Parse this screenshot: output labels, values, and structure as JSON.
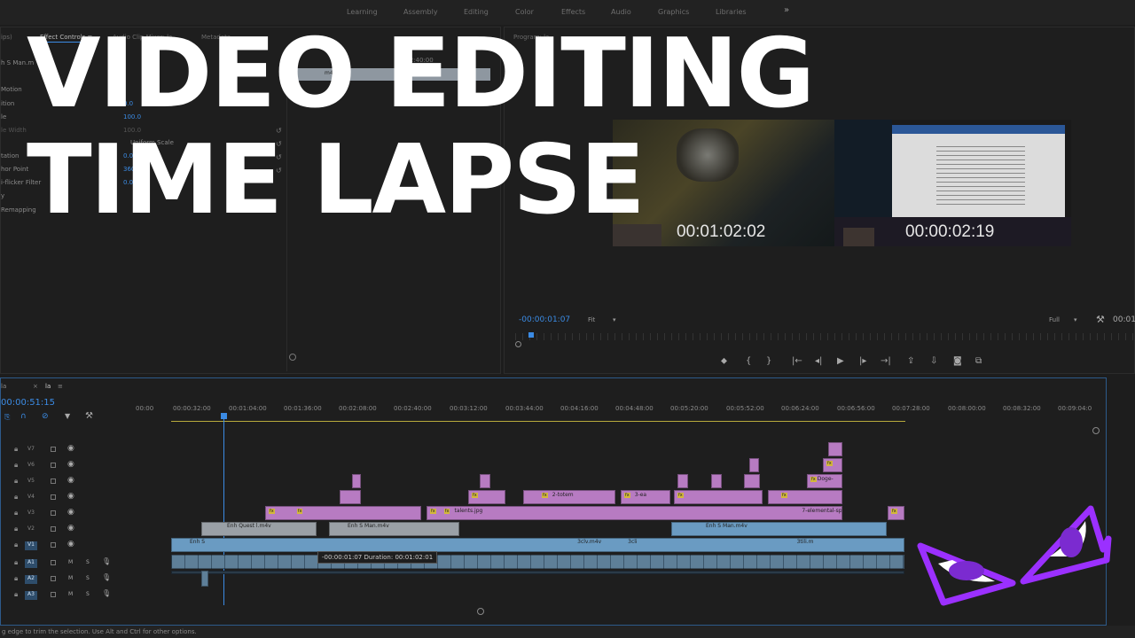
{
  "workspaces": [
    "Learning",
    "Assembly",
    "Editing",
    "Color",
    "Effects",
    "Audio",
    "Graphics",
    "Libraries"
  ],
  "workspace_more": "»",
  "effect_controls": {
    "tabs": [
      "ips)",
      "Effect Controls ≡",
      "Audio Clip Mixer: la",
      "Metadata"
    ],
    "clip_name": "h S Man.m",
    "rows": [
      "Motion",
      "ition",
      "le",
      "le Width",
      "",
      "Uniform Scale",
      "tation",
      "hor Point",
      "i-flicker Filter",
      "y",
      "Remapping"
    ],
    "values": [
      "0.0",
      "100.0",
      "100.0",
      "0",
      "0.0",
      "360.0",
      "0.00"
    ],
    "mini_timecode": "00:02:40:00",
    "mini_clip": "m4v"
  },
  "program_monitor": {
    "tab": "Program: la",
    "timecode_left": "-00:00:01:07",
    "fit_label": "Fit",
    "full_label": "Full",
    "timecode_right": "00:01",
    "preview_timecode_1": "00:01:02:02",
    "preview_timecode_2": "00:00:02:19"
  },
  "headline": {
    "line1": "VIDEO EDITING",
    "line2": "TIME LAPSE"
  },
  "timeline": {
    "tab_close": "×",
    "tab_name": "la",
    "tab_menu": "≡",
    "sequence_left_tab": "la",
    "current_time": "00:00:51:15",
    "ruler": [
      "00:00",
      "00:00:32:00",
      "00:01:04:00",
      "00:01:36:00",
      "00:02:08:00",
      "00:02:40:00",
      "00:03:12:00",
      "00:03:44:00",
      "00:04:16:00",
      "00:04:48:00",
      "00:05:20:00",
      "00:05:52:00",
      "00:06:24:00",
      "00:06:56:00",
      "00:07:28:00",
      "00:08:00:00",
      "00:08:32:00",
      "00:09:04:0"
    ],
    "video_tracks": [
      "V7",
      "V6",
      "V5",
      "V4",
      "V3",
      "V2",
      "V1"
    ],
    "audio_tracks": [
      "A1",
      "A2",
      "A3"
    ],
    "track_m": "M",
    "track_s": "S",
    "fx_label": "fx",
    "clip_labels": {
      "talents": "talents.jpg",
      "totem": "2-totem",
      "three": "3-ea",
      "elemental": "7-elemental-sp",
      "doge": "Doge-",
      "enh_quest": "Enh Quest l.m4v",
      "enh_s_man": "Enh S Man.m4v",
      "enh_s_man2": "Enh S Man.m4v",
      "enh_s": "Enh S",
      "v1_a": "3clv.m4v",
      "v1_b": "3cli",
      "v1_c": "3tili.m"
    },
    "tooltip": "-00:00:01:07  Duration: 00:01:02:01"
  },
  "status_bar": "g edge to trim the selection. Use Alt and Ctrl for other options.",
  "colors": {
    "accent_blue": "#3b8be4",
    "clip_pink": "#b77bc2",
    "clip_blue": "#6a9bc2",
    "logo_purple": "#9b30ff"
  },
  "icons": [
    "wrench-icon",
    "play-icon",
    "step-back-icon",
    "step-forward-icon",
    "camera-icon",
    "marker-icon",
    "snap-icon",
    "link-icon",
    "eye-icon",
    "mic-icon",
    "lock-icon",
    "film-icon"
  ]
}
